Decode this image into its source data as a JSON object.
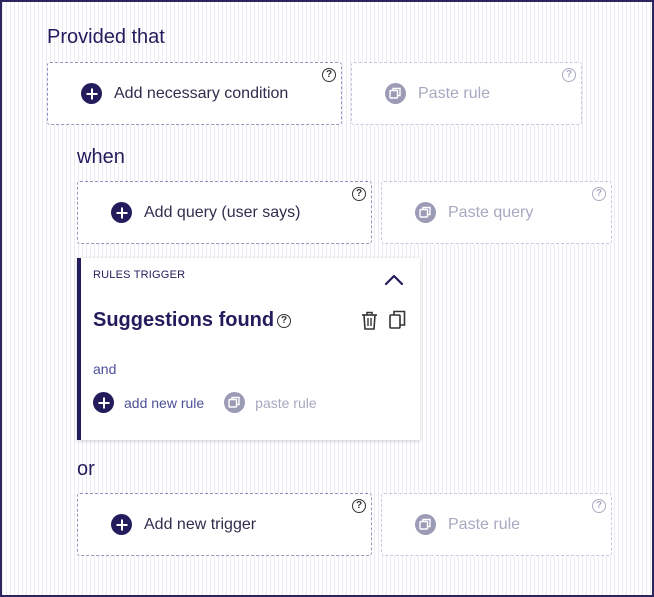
{
  "sections": {
    "provided": {
      "heading": "Provided that",
      "add_label": "Add necessary condition",
      "paste_label": "Paste rule",
      "help_glyph": "?"
    },
    "when": {
      "heading": "when",
      "add_label": "Add query (user says)",
      "paste_label": "Paste query",
      "help_glyph": "?"
    },
    "trigger_card": {
      "kicker": "RULES TRIGGER",
      "title": "Suggestions found",
      "help_glyph": "?",
      "and_label": "and",
      "add_rule_label": "add new rule",
      "paste_rule_label": "paste rule"
    },
    "or": {
      "heading": "or",
      "add_label": "Add new trigger",
      "paste_label": "Paste rule",
      "help_glyph": "?"
    }
  },
  "icons": {
    "add": "plus-circle-icon",
    "paste": "paste-icon",
    "help": "help-circle-icon",
    "collapse": "chevron-up-icon",
    "delete": "trash-icon",
    "duplicate": "copy-icon"
  },
  "colors": {
    "primary": "#231c5c",
    "link": "#4d5096",
    "muted": "#a6a9c0",
    "paste_icon_bg": "#9c9bb6",
    "frame_border": "#2b2560"
  }
}
